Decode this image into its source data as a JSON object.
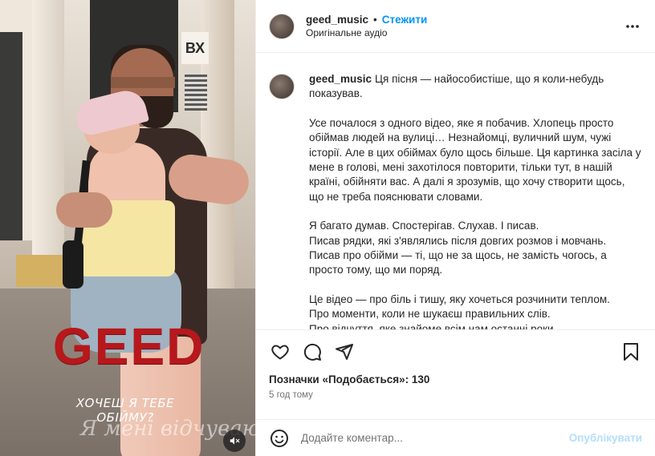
{
  "media": {
    "overlay_title": "GEED",
    "overlay_subtitle": "ХОЧЕШ Я ТЕБЕ ОБІЙМУ?",
    "sign_text": "ВХ",
    "scribble_text": "Я мені відчуваю",
    "mute_icon": "speaker-muted-icon"
  },
  "header": {
    "username": "geed_music",
    "separator": "•",
    "follow_label": "Стежити",
    "audio_label": "Оригінальне аудіо",
    "more_icon": "more-horizontal-icon"
  },
  "caption": {
    "username": "geed_music",
    "paragraphs": [
      [
        "Ця пісня — найособистіше, що я коли-небудь показував."
      ],
      [
        "Усе почалося з одного відео, яке я побачив. Хлопець просто обіймав людей на вулиці… Незнайомці, вуличний шум, чужі історії. Але в цих обіймах було щось більше. Ця картинка засіла у мене в голові, мені захотілося повторити, тільки тут, в нашій країні, обійняти вас. А далі я зрозумів, що хочу створити щось, що не треба пояснювати словами."
      ],
      [
        "Я багато думав. Спостерігав. Слухав. І писав.",
        "Писав рядки, які з'являлись після довгих розмов і мовчань.",
        "Писав про обійми — ті, що не за щось, не замість чогось, а просто тому, що ми поряд."
      ],
      [
        "Це відео — про біль і тишу, яку хочеться розчинити теплом.",
        "Про моменти, коли не шукаєш правильних слів.",
        "Про відчуття, яке знайоме всім нам останні роки."
      ]
    ]
  },
  "actions": {
    "like_icon": "heart-icon",
    "comment_icon": "comment-icon",
    "share_icon": "share-icon",
    "save_icon": "bookmark-icon",
    "likes_label": "Позначки «Подобається»: 130",
    "time_label": "5 год тому"
  },
  "comment_box": {
    "emoji_icon": "emoji-icon",
    "placeholder": "Додайте коментар...",
    "post_label": "Опублікувати"
  },
  "colors": {
    "accent": "#0095f6",
    "post_disabled": "#b2dffc",
    "overlay_red": "#b6181c"
  }
}
